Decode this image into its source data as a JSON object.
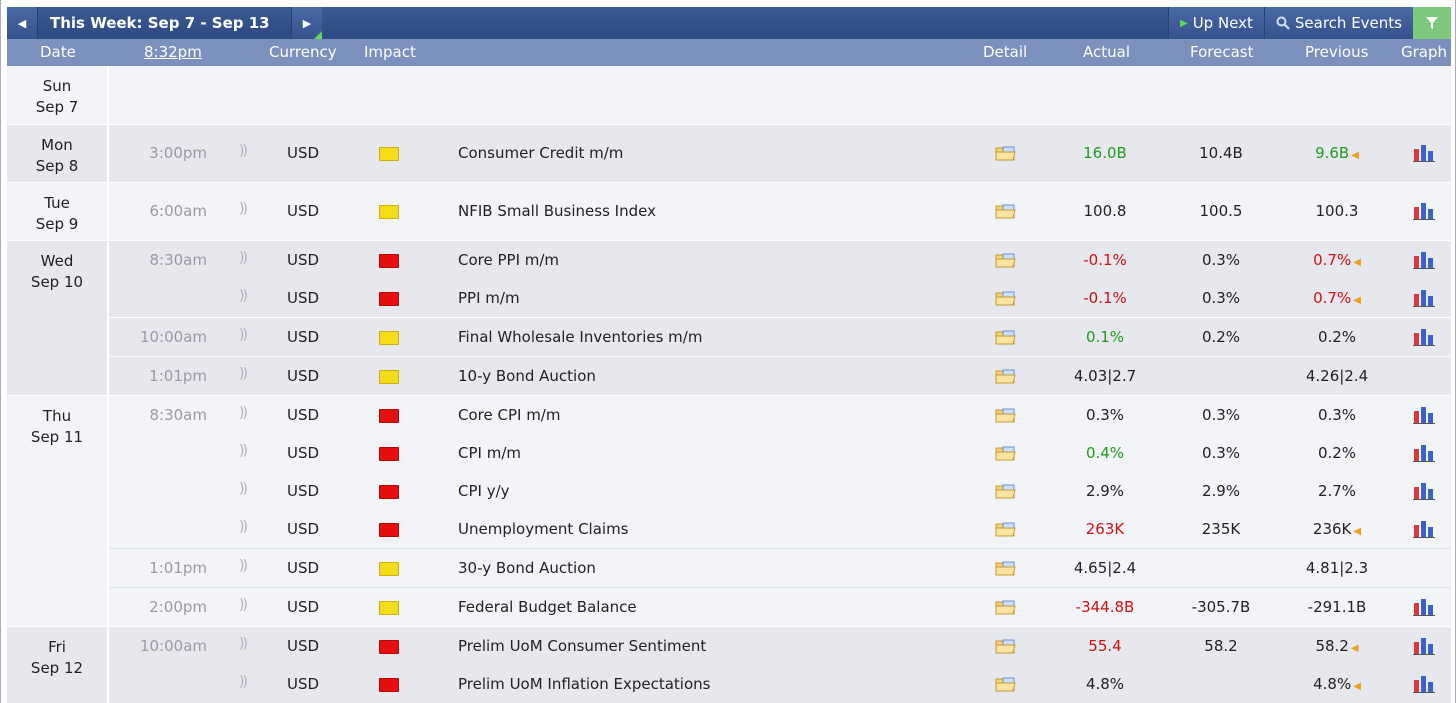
{
  "nav": {
    "week_title": "This Week: Sep 7 - Sep 13",
    "up_next": "Up Next",
    "search_events": "Search Events"
  },
  "columns": {
    "date": "Date",
    "time": "8:32pm",
    "currency": "Currency",
    "impact": "Impact",
    "detail": "Detail",
    "actual": "Actual",
    "forecast": "Forecast",
    "previous": "Previous",
    "graph": "Graph"
  },
  "days": [
    {
      "dow": "Sun",
      "date": "Sep 7"
    },
    {
      "dow": "Mon",
      "date": "Sep 8"
    },
    {
      "dow": "Tue",
      "date": "Sep 9"
    },
    {
      "dow": "Wed",
      "date": "Sep 10"
    },
    {
      "dow": "Thu",
      "date": "Sep 11"
    },
    {
      "dow": "Fri",
      "date": "Sep 12"
    }
  ],
  "events": [
    {
      "time": "3:00pm",
      "currency": "USD",
      "impact": "yellow",
      "name": "Consumer Credit m/m",
      "actual": "16.0B",
      "forecast": "10.4B",
      "previous": "9.6B"
    },
    {
      "time": "6:00am",
      "currency": "USD",
      "impact": "yellow",
      "name": "NFIB Small Business Index",
      "actual": "100.8",
      "forecast": "100.5",
      "previous": "100.3"
    },
    {
      "time": "8:30am",
      "currency": "USD",
      "impact": "red",
      "name": "Core PPI m/m",
      "actual": "-0.1%",
      "forecast": "0.3%",
      "previous": "0.7%"
    },
    {
      "time": "",
      "currency": "USD",
      "impact": "red",
      "name": "PPI m/m",
      "actual": "-0.1%",
      "forecast": "0.3%",
      "previous": "0.7%"
    },
    {
      "time": "10:00am",
      "currency": "USD",
      "impact": "yellow",
      "name": "Final Wholesale Inventories m/m",
      "actual": "0.1%",
      "forecast": "0.2%",
      "previous": "0.2%"
    },
    {
      "time": "1:01pm",
      "currency": "USD",
      "impact": "yellow",
      "name": "10-y Bond Auction",
      "actual": "4.03|2.7",
      "forecast": "",
      "previous": "4.26|2.4"
    },
    {
      "time": "8:30am",
      "currency": "USD",
      "impact": "red",
      "name": "Core CPI m/m",
      "actual": "0.3%",
      "forecast": "0.3%",
      "previous": "0.3%"
    },
    {
      "time": "",
      "currency": "USD",
      "impact": "red",
      "name": "CPI m/m",
      "actual": "0.4%",
      "forecast": "0.3%",
      "previous": "0.2%"
    },
    {
      "time": "",
      "currency": "USD",
      "impact": "red",
      "name": "CPI y/y",
      "actual": "2.9%",
      "forecast": "2.9%",
      "previous": "2.7%"
    },
    {
      "time": "",
      "currency": "USD",
      "impact": "red",
      "name": "Unemployment Claims",
      "actual": "263K",
      "forecast": "235K",
      "previous": "236K"
    },
    {
      "time": "1:01pm",
      "currency": "USD",
      "impact": "yellow",
      "name": "30-y Bond Auction",
      "actual": "4.65|2.4",
      "forecast": "",
      "previous": "4.81|2.3"
    },
    {
      "time": "2:00pm",
      "currency": "USD",
      "impact": "yellow",
      "name": "Federal Budget Balance",
      "actual": "-344.8B",
      "forecast": "-305.7B",
      "previous": "-291.1B"
    },
    {
      "time": "10:00am",
      "currency": "USD",
      "impact": "red",
      "name": "Prelim UoM Consumer Sentiment",
      "actual": "55.4",
      "forecast": "58.2",
      "previous": "58.2"
    },
    {
      "time": "",
      "currency": "USD",
      "impact": "red",
      "name": "Prelim UoM Inflation Expectations",
      "actual": "4.8%",
      "forecast": "",
      "previous": "4.8%"
    }
  ],
  "colors": {
    "topbar": "#2d4a82",
    "header": "#7b90bd",
    "better": "#1f9a1f",
    "worse": "#cc1111",
    "impact_high": "#e50f0f",
    "impact_medium": "#f3dc1a"
  }
}
